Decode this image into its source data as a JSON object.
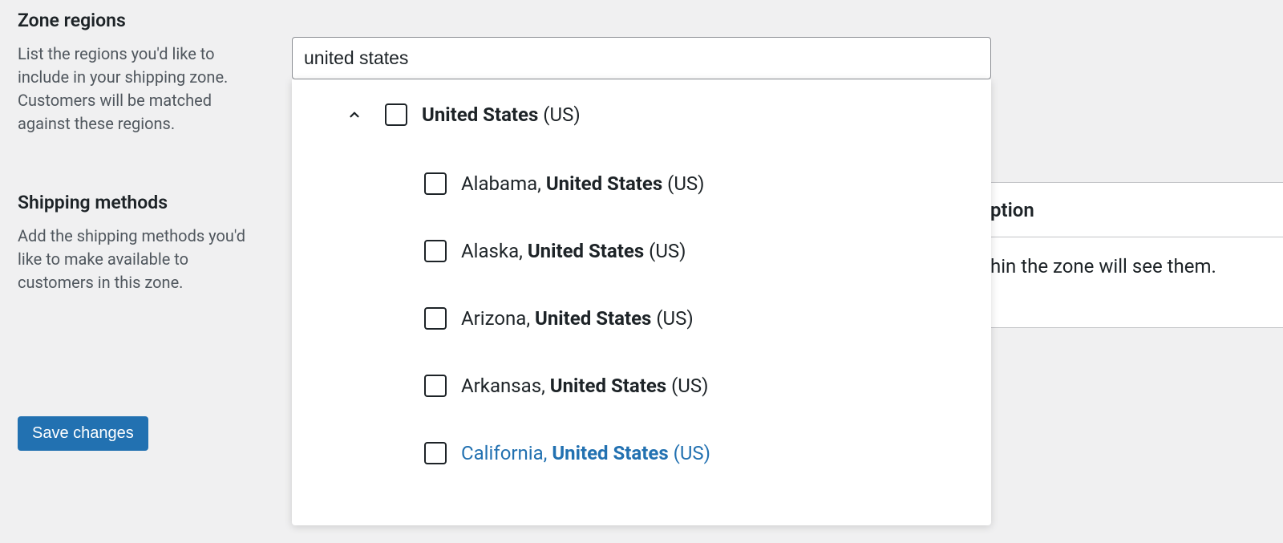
{
  "sections": {
    "zone_regions": {
      "title": "Zone regions",
      "desc": "List the regions you'd like to include in your shipping zone. Customers will be matched against these regions."
    },
    "shipping_methods": {
      "title": "Shipping methods",
      "desc": "Add the shipping methods you'd like to make available to customers in this zone."
    }
  },
  "search_value": "united states",
  "dropdown": {
    "parent": {
      "label_bold": "United States",
      "label_normal": " (US)"
    },
    "children": [
      {
        "prefix": "Alabama, ",
        "bold": "United States",
        "suffix": " (US)",
        "highlighted": false
      },
      {
        "prefix": "Alaska, ",
        "bold": "United States",
        "suffix": " (US)",
        "highlighted": false
      },
      {
        "prefix": "Arizona, ",
        "bold": "United States",
        "suffix": " (US)",
        "highlighted": false
      },
      {
        "prefix": "Arkansas, ",
        "bold": "United States",
        "suffix": " (US)",
        "highlighted": false
      },
      {
        "prefix": "California, ",
        "bold": "United States",
        "suffix": " (US)",
        "highlighted": true
      }
    ]
  },
  "save_button": "Save changes",
  "table_hint": {
    "header": "ption",
    "body": "hin the zone will see them."
  }
}
